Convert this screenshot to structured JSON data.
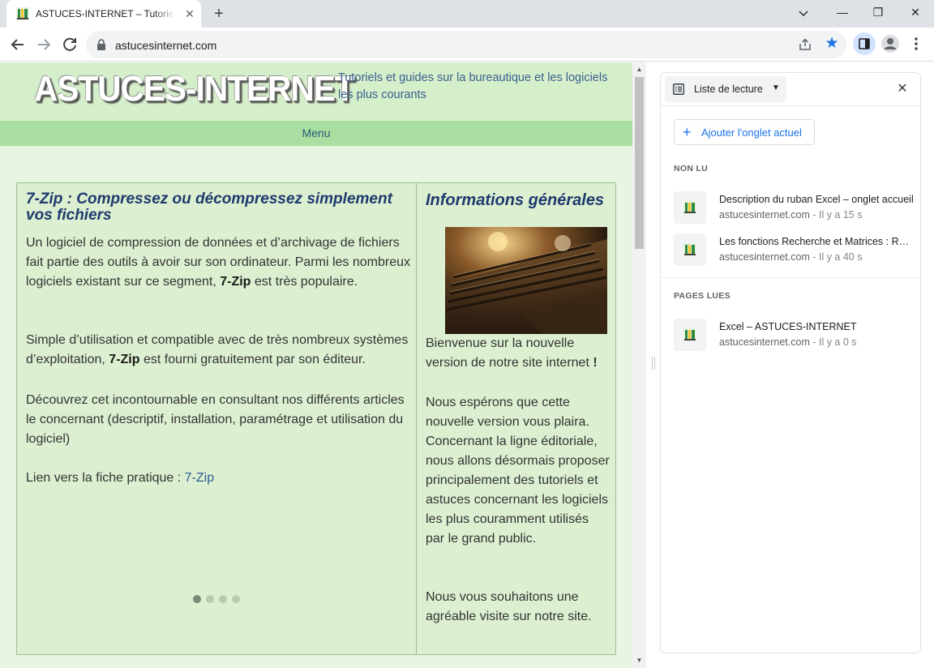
{
  "browser": {
    "tab": {
      "title": "ASTUCES-INTERNET – Tutoriels et guides",
      "close": "✕"
    },
    "new_tab": "+",
    "window": {
      "minimize": "—",
      "maximize": "❐",
      "close": "✕"
    },
    "url": "astucesinternet.com"
  },
  "site": {
    "logo": "ASTUCES-INTERNET",
    "tagline": "Tutoriels et guides sur la bureautique et les logiciels les plus courants",
    "menu": "Menu"
  },
  "article": {
    "title": "7-Zip : Compressez ou décompressez simplement vos fichiers",
    "p1": {
      "before": "Un logiciel de compression de données et d’archivage de fichiers fait partie des outils à avoir sur son ordinateur. Parmi les nombreux logiciels existant sur ce segment, ",
      "bold": "7-Zip",
      "after": " est très populaire."
    },
    "p2": {
      "before": "Simple d’utilisation et compatible avec de très nombreux systèmes d’exploitation, ",
      "bold": "7-Zip",
      "after": " est fourni gratuitement par son éditeur."
    },
    "p3": "Découvrez cet incontournable en consultant nos différents articles le concernant (descriptif, installation, paramétrage et utilisation du logiciel)",
    "p4_prefix": "Lien vers la fiche pratique : ",
    "p4_link": "7-Zip",
    "carousel": {
      "count": 4,
      "active": 1
    }
  },
  "sidebar": {
    "title": "Informations générales",
    "p1": {
      "before": "Bienvenue sur la nouvelle version de notre site internet ",
      "bold": "!"
    },
    "p2": "Nous espérons que cette nouvelle version vous plaira. Concernant la ligne éditoriale, nous allons désormais proposer principalement des tutoriels et astuces concernant les logiciels les plus couramment utilisés par le grand public.",
    "p3": "Nous vous souhaitons une agréable visite sur notre site."
  },
  "reading_list": {
    "selector_label": "Liste de lecture",
    "add_button": "Ajouter l'onglet actuel",
    "unread_label": "NON LU",
    "read_label": "PAGES LUES",
    "unread": [
      {
        "title": "Description du ruban Excel – onglet accueil",
        "domain": "astucesinternet.com",
        "time": "Il y a 15 s"
      },
      {
        "title": "Les fonctions Recherche et Matrices : RECHERCHEV",
        "domain": "astucesinternet.com",
        "time": "Il y a 40 s"
      }
    ],
    "read": [
      {
        "title": "Excel – ASTUCES-INTERNET",
        "domain": "astucesinternet.com",
        "time": "Il y a 0 s"
      }
    ],
    "separator": " - "
  },
  "colors": {
    "accent": "#1a73e8",
    "site_green": "#a8dea0",
    "title_blue": "#1e3a6e"
  }
}
